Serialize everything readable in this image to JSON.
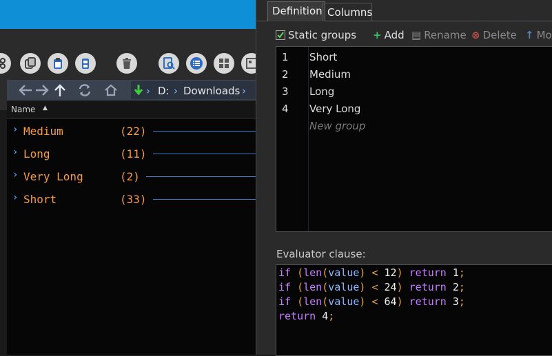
{
  "explorer": {
    "address": {
      "drive": "D:",
      "folder": "Downloads"
    },
    "column_header": "Name",
    "groups": [
      {
        "name": "Medium",
        "count": "(22)"
      },
      {
        "name": "Long",
        "count": "(11)"
      },
      {
        "name": "Very Long",
        "count": "(2)"
      },
      {
        "name": "Short",
        "count": "(33)"
      }
    ]
  },
  "dialog": {
    "tabs": [
      "Definition",
      "Columns"
    ],
    "static_groups_label": "Static groups",
    "static_groups_checked": true,
    "toolbar": {
      "add": "Add",
      "rename": "Rename",
      "delete": "Delete",
      "move": "Mo"
    },
    "groups": [
      {
        "num": "1",
        "label": "Short"
      },
      {
        "num": "2",
        "label": "Medium"
      },
      {
        "num": "3",
        "label": "Long"
      },
      {
        "num": "4",
        "label": "Very Long"
      }
    ],
    "new_group_placeholder": "New group",
    "evaluator_label": "Evaluator clause:",
    "code": {
      "kw_if": "if",
      "kw_return": "return",
      "fn_len": "len",
      "var": "value",
      "op_lt": "<",
      "thresholds": [
        "12",
        "24",
        "64"
      ],
      "returns": [
        "1",
        "2",
        "3",
        "4"
      ]
    }
  },
  "colors": {
    "accent_blue": "#0e8fd6",
    "group_orange": "#f59b4a",
    "chevron_blue": "#3fa3ff",
    "keyword_purple": "#c77dff"
  }
}
